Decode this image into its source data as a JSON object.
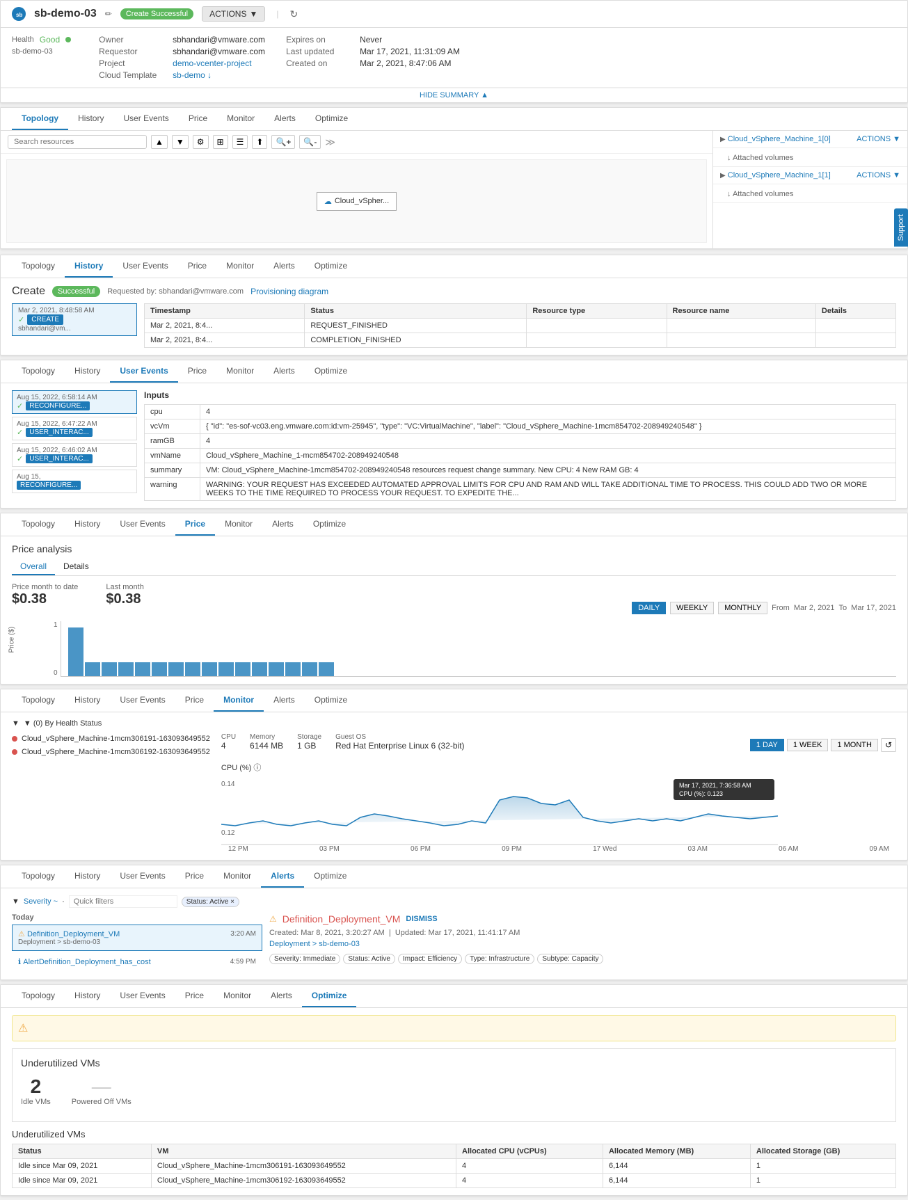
{
  "header": {
    "logo_text": "sb",
    "title": "sb-demo-03",
    "edit_icon": "✏",
    "badge": "Create Successful",
    "actions_label": "ACTIONS",
    "refresh_icon": "↻"
  },
  "summary": {
    "health_label": "Health",
    "health_value": "Good",
    "device_label": "sb-demo-03",
    "hide_summary": "HIDE SUMMARY ▲",
    "fields": {
      "owner_label": "Owner",
      "owner_value": "sbhandari@vmware.com",
      "requestor_label": "Requestor",
      "requestor_value": "sbhandari@vmware.com",
      "project_label": "Project",
      "project_value": "demo-vcenter-project",
      "cloud_template_label": "Cloud Template",
      "cloud_template_value": "sb-demo ↓",
      "expires_label": "Expires on",
      "expires_value": "Never",
      "last_updated_label": "Last updated",
      "last_updated_value": "Mar 17, 2021, 11:31:09 AM",
      "created_label": "Created on",
      "created_value": "Mar 2, 2021, 8:47:06 AM"
    }
  },
  "tabs": {
    "topology": "Topology",
    "history": "History",
    "user_events": "User Events",
    "price": "Price",
    "monitor": "Monitor",
    "alerts": "Alerts",
    "optimize": "Optimize"
  },
  "topology_panel": {
    "tab_active": "Topology",
    "search_placeholder": "Search resources",
    "expand_icon": "≫",
    "vm_node": "Cloud_vSpher...",
    "resources": [
      {
        "name": "Cloud_vSphere_Machine_1[0]",
        "actions": "ACTIONS ▼",
        "sub": "↓ Attached volumes"
      },
      {
        "name": "Cloud_vSphere_Machine_1[1]",
        "actions": "ACTIONS ▼",
        "sub": "↓ Attached volumes"
      }
    ]
  },
  "history_panel": {
    "tab_active": "History",
    "create_title": "Create",
    "badge": "Successful",
    "requested_by": "Requested by: sbhandari@vmware.com",
    "provisioning_link": "Provisioning diagram",
    "event": {
      "date": "Mar 2, 2021,",
      "time": "8:48:58 AM",
      "user": "sbhandari@vm...",
      "badge": "CREATE"
    },
    "table": {
      "headers": [
        "Timestamp",
        "Status",
        "Resource type",
        "Resource name",
        "Details"
      ],
      "rows": [
        {
          "timestamp": "Mar 2, 2021, 8:4...",
          "status": "REQUEST_FINISHED",
          "resource_type": "",
          "resource_name": "",
          "details": ""
        },
        {
          "timestamp": "Mar 2, 2021, 8:4...",
          "status": "COMPLETION_FINISHED",
          "resource_type": "",
          "resource_name": "",
          "details": ""
        }
      ]
    }
  },
  "user_events_panel": {
    "tab_active": "User Events",
    "inputs_title": "Inputs",
    "events": [
      {
        "date": "Aug 15, 2022,",
        "time": "6:58:14 AM",
        "badge": "RECONFIGURE...",
        "badge_color": "blue",
        "check": true
      },
      {
        "date": "Aug 15, 2022,",
        "time": "6:47:22 AM",
        "badge": "USER_INTERAC...",
        "badge_color": "blue",
        "check": true
      },
      {
        "date": "Aug 15, 2022,",
        "time": "6:46:02 AM",
        "badge": "USER_INTERAC...",
        "badge_color": "blue",
        "check": true
      },
      {
        "date": "Aug 15,",
        "time": "",
        "badge": "RECONFIGURE...",
        "badge_color": "blue",
        "check": false
      }
    ],
    "inputs": [
      {
        "key": "cpu",
        "value": "4"
      },
      {
        "key": "vcVm",
        "value": "{ \"id\": \"es-sof-vc03.eng.vmware.com:id:vm-25945\", \"type\": \"VC:VirtualMachine\", \"label\": \"Cloud_vSphere_Machine-1mcm854702-208949240548\" }"
      },
      {
        "key": "ramGB",
        "value": "4"
      },
      {
        "key": "vmName",
        "value": "Cloud_vSphere_Machine-1mcm854702-208949240548"
      },
      {
        "key": "summary",
        "value": "VM: Cloud_vSphere_Machine-1mcm854702-208949240548 resources request change summary. New CPU: 4 New RAM GB: 4"
      },
      {
        "key": "warning",
        "value": "WARNING: YOUR REQUEST HAS EXCEEDED AUTOMATED APPROVAL LIMITS FOR CPU AND RAM AND WILL TAKE ADDITIONAL TIME TO PROCESS. THIS COULD ADD TWO OR MORE WEEKS TO THE TIME REQUIRED TO PROCESS YOUR REQUEST. TO EXPEDITE THE..."
      }
    ]
  },
  "price_panel": {
    "tab_active": "Price",
    "title": "Price analysis",
    "subtabs": [
      "Overall",
      "Details"
    ],
    "active_subtab": "Overall",
    "price_month_to_date_label": "Price month to date",
    "price_month_to_date_value": "$0.38",
    "last_month_label": "Last month",
    "last_month_value": "$0.38",
    "period_buttons": [
      "DAILY",
      "WEEKLY",
      "MONTHLY"
    ],
    "active_period": "DAILY",
    "from_label": "From",
    "from_date": "Mar 2, 2021",
    "to_label": "To",
    "to_date": "Mar 17, 2021",
    "y_max": "1",
    "y_zero": "0",
    "y_axis_label": "Price ($)",
    "bars": [
      70,
      20,
      20,
      20,
      20,
      20,
      20,
      20,
      20,
      20,
      20,
      20,
      20,
      20,
      20,
      20
    ]
  },
  "monitor_panel": {
    "tab_active": "Monitor",
    "filter_title": "▼ (0) By Health Status",
    "vms": [
      "Cloud_vSphere_Machine-1mcm306191-163093649552",
      "Cloud_vSphere_Machine-1mcm306192-163093649552"
    ],
    "detail": {
      "cpu_label": "CPU",
      "cpu_value": "4",
      "memory_label": "Memory",
      "memory_value": "6144 MB",
      "storage_label": "Storage",
      "storage_value": "1 GB",
      "os_label": "Guest OS",
      "os_value": "Red Hat Enterprise Linux 6 (32-bit)"
    },
    "period_buttons": [
      "1 DAY",
      "1 WEEK",
      "1 MONTH"
    ],
    "active_period": "1 DAY",
    "cpu_chart_title": "CPU (%) ⓘ",
    "y_values": [
      "0.14",
      "0.12"
    ],
    "x_labels": [
      "12 PM",
      "03 PM",
      "06 PM",
      "09 PM",
      "17 Wed",
      "03 AM",
      "06 AM",
      "09 AM"
    ],
    "tooltip": {
      "date": "Mar 17, 2021, 7:36:58 AM",
      "value": "CPU (%): 0.123"
    }
  },
  "alerts_panel": {
    "tab_active": "Alerts",
    "severity_label": "Severity ~",
    "quick_filters_placeholder": "Quick filters",
    "status_tag": "Status: Active ×",
    "section_today": "Today",
    "alerts": [
      {
        "icon": "warn",
        "name": "Definition_Deployment_VM",
        "time": "3:20 AM",
        "sub": "Deployment > sb-demo-03"
      },
      {
        "icon": "info",
        "name": "AlertDefinition_Deployment_has_cost",
        "time": "4:59 PM",
        "sub": ""
      }
    ],
    "detail": {
      "name": "Definition_Deployment_VM",
      "dismiss": "DISMISS",
      "created": "Created: Mar 8, 2021, 3:20:27 AM",
      "updated": "Updated: Mar 17, 2021, 11:41:17 AM",
      "path": "Deployment > sb-demo-03",
      "tags": [
        "Severity: Immediate",
        "Status: Active",
        "Impact: Efficiency",
        "Type: Infrastructure",
        "Subtype: Capacity"
      ]
    }
  },
  "optimize_panel": {
    "tab_active": "Optimize",
    "warning_text": "",
    "underutilized_title": "Underutilized VMs",
    "idle_vms_label": "Idle VMs",
    "idle_vms_value": "2",
    "powered_off_label": "Powered Off VMs",
    "powered_off_value": "—",
    "table_title": "Underutilized VMs",
    "table_headers": [
      "Status",
      "VM",
      "Allocated CPU (vCPUs)",
      "Allocated Memory (MB)",
      "Allocated Storage (GB)"
    ],
    "table_rows": [
      {
        "status": "Idle since Mar 09, 2021",
        "vm": "Cloud_vSphere_Machine-1mcm306191-163093649552",
        "cpu": "4",
        "memory": "6,144",
        "storage": "1"
      },
      {
        "status": "Idle since Mar 09, 2021",
        "vm": "Cloud_vSphere_Machine-1mcm306192-163093649552",
        "cpu": "4",
        "memory": "6,144",
        "storage": "1"
      }
    ]
  },
  "support": {
    "label": "Support"
  }
}
